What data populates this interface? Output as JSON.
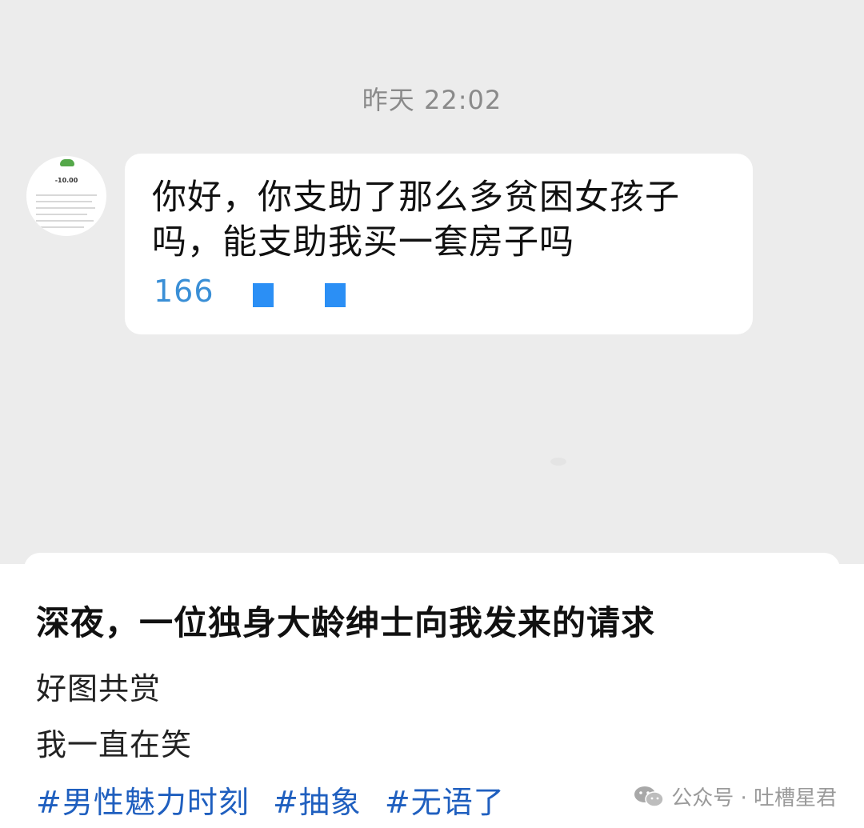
{
  "chat": {
    "timestamp": "昨天 22:02",
    "avatar": {
      "amount": "-10.00"
    },
    "message": {
      "text": "你好，你支助了那么多贫困女孩子吗，能支助我买一套房子吗",
      "phone_partial": "166"
    }
  },
  "post": {
    "title": "深夜，一位独身大龄绅士向我发来的请求",
    "lines": [
      "好图共赏",
      "我一直在笑"
    ],
    "tags": [
      "#男性魅力时刻",
      "#抽象",
      "#无语了"
    ]
  },
  "watermark": {
    "icon": "wechat-icon",
    "text": "公众号 · 吐槽星君"
  },
  "colors": {
    "chat_bg": "#ececec",
    "bubble_bg": "#ffffff",
    "link_blue": "#3a8fd6",
    "redaction_blue": "#2b8ff5",
    "hashtag_blue": "#1f5fbf"
  }
}
